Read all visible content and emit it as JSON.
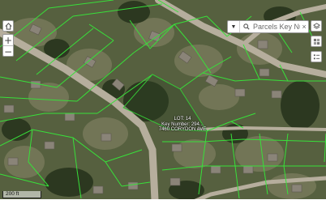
{
  "controls": {
    "home_icon": "home-icon",
    "zoom_in_label": "+",
    "zoom_out_label": "−",
    "layers_icon": "layers-icon",
    "basemap_icon": "basemap-gallery-icon",
    "legend_icon": "legend-icon"
  },
  "search": {
    "dropdown_icon": "caret-down-icon",
    "search_icon": "search-icon",
    "placeholder": "Parcels Key Nu...",
    "clear_label": "×"
  },
  "parcel_label": {
    "line1": "LOT: 14",
    "line2": "Key Number: 294...",
    "line3": "7460 CORYDON AVE"
  },
  "scale_bar": {
    "label": "200 ft"
  },
  "colors": {
    "parcel_lines": "#38e03a",
    "road": "#b9b2a3",
    "vegetation_dark": "#2f3b22",
    "vegetation_light": "#6f7552"
  }
}
